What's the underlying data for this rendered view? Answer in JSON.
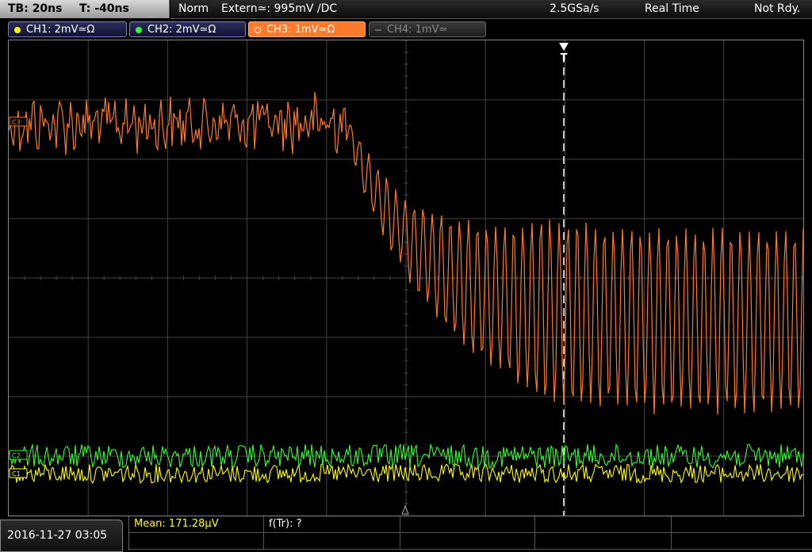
{
  "top": {
    "timebase": "TB: 20ns",
    "trigger_time": "T: -40ns",
    "mode": "Norm",
    "trigger_source": "Extern≃: 995mV ∕DC",
    "sample_rate": "2.5GSa/s",
    "acq_mode": "Real Time",
    "state": "Not Rdy."
  },
  "channels": [
    {
      "label": "CH1: 2mV≃Ω",
      "color": "#ffff00"
    },
    {
      "label": "CH2: 2mV≃Ω",
      "color": "#33ff33"
    },
    {
      "label": "CH3: 1mV≃Ω",
      "color": "#ff7a2a"
    },
    {
      "label": "CH4: 1mV≃",
      "color": "#888888"
    }
  ],
  "markers": {
    "ch3": "C3",
    "ch2": "C2",
    "ch1": "C1",
    "trigger": "T"
  },
  "bottom": {
    "datetime": "2016-11-27 03:05",
    "mean": "Mean: 171.28µV",
    "ftr": "f(Tr): ?"
  },
  "colors": {
    "grid": "#444444",
    "ch1": "#ffff00",
    "ch2": "#33ff33",
    "ch3": "#ff7a2a"
  }
}
